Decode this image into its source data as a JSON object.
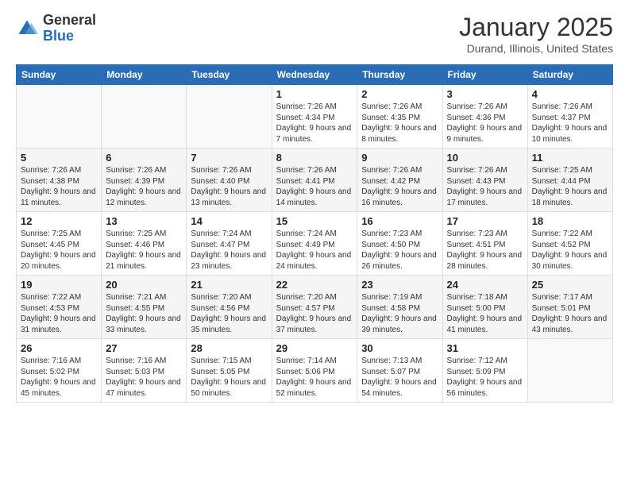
{
  "logo": {
    "general": "General",
    "blue": "Blue"
  },
  "title": "January 2025",
  "location": "Durand, Illinois, United States",
  "days_of_week": [
    "Sunday",
    "Monday",
    "Tuesday",
    "Wednesday",
    "Thursday",
    "Friday",
    "Saturday"
  ],
  "weeks": [
    [
      {
        "day": "",
        "info": ""
      },
      {
        "day": "",
        "info": ""
      },
      {
        "day": "",
        "info": ""
      },
      {
        "day": "1",
        "info": "Sunrise: 7:26 AM\nSunset: 4:34 PM\nDaylight: 9 hours and 7 minutes."
      },
      {
        "day": "2",
        "info": "Sunrise: 7:26 AM\nSunset: 4:35 PM\nDaylight: 9 hours and 8 minutes."
      },
      {
        "day": "3",
        "info": "Sunrise: 7:26 AM\nSunset: 4:36 PM\nDaylight: 9 hours and 9 minutes."
      },
      {
        "day": "4",
        "info": "Sunrise: 7:26 AM\nSunset: 4:37 PM\nDaylight: 9 hours and 10 minutes."
      }
    ],
    [
      {
        "day": "5",
        "info": "Sunrise: 7:26 AM\nSunset: 4:38 PM\nDaylight: 9 hours and 11 minutes."
      },
      {
        "day": "6",
        "info": "Sunrise: 7:26 AM\nSunset: 4:39 PM\nDaylight: 9 hours and 12 minutes."
      },
      {
        "day": "7",
        "info": "Sunrise: 7:26 AM\nSunset: 4:40 PM\nDaylight: 9 hours and 13 minutes."
      },
      {
        "day": "8",
        "info": "Sunrise: 7:26 AM\nSunset: 4:41 PM\nDaylight: 9 hours and 14 minutes."
      },
      {
        "day": "9",
        "info": "Sunrise: 7:26 AM\nSunset: 4:42 PM\nDaylight: 9 hours and 16 minutes."
      },
      {
        "day": "10",
        "info": "Sunrise: 7:26 AM\nSunset: 4:43 PM\nDaylight: 9 hours and 17 minutes."
      },
      {
        "day": "11",
        "info": "Sunrise: 7:25 AM\nSunset: 4:44 PM\nDaylight: 9 hours and 18 minutes."
      }
    ],
    [
      {
        "day": "12",
        "info": "Sunrise: 7:25 AM\nSunset: 4:45 PM\nDaylight: 9 hours and 20 minutes."
      },
      {
        "day": "13",
        "info": "Sunrise: 7:25 AM\nSunset: 4:46 PM\nDaylight: 9 hours and 21 minutes."
      },
      {
        "day": "14",
        "info": "Sunrise: 7:24 AM\nSunset: 4:47 PM\nDaylight: 9 hours and 23 minutes."
      },
      {
        "day": "15",
        "info": "Sunrise: 7:24 AM\nSunset: 4:49 PM\nDaylight: 9 hours and 24 minutes."
      },
      {
        "day": "16",
        "info": "Sunrise: 7:23 AM\nSunset: 4:50 PM\nDaylight: 9 hours and 26 minutes."
      },
      {
        "day": "17",
        "info": "Sunrise: 7:23 AM\nSunset: 4:51 PM\nDaylight: 9 hours and 28 minutes."
      },
      {
        "day": "18",
        "info": "Sunrise: 7:22 AM\nSunset: 4:52 PM\nDaylight: 9 hours and 30 minutes."
      }
    ],
    [
      {
        "day": "19",
        "info": "Sunrise: 7:22 AM\nSunset: 4:53 PM\nDaylight: 9 hours and 31 minutes."
      },
      {
        "day": "20",
        "info": "Sunrise: 7:21 AM\nSunset: 4:55 PM\nDaylight: 9 hours and 33 minutes."
      },
      {
        "day": "21",
        "info": "Sunrise: 7:20 AM\nSunset: 4:56 PM\nDaylight: 9 hours and 35 minutes."
      },
      {
        "day": "22",
        "info": "Sunrise: 7:20 AM\nSunset: 4:57 PM\nDaylight: 9 hours and 37 minutes."
      },
      {
        "day": "23",
        "info": "Sunrise: 7:19 AM\nSunset: 4:58 PM\nDaylight: 9 hours and 39 minutes."
      },
      {
        "day": "24",
        "info": "Sunrise: 7:18 AM\nSunset: 5:00 PM\nDaylight: 9 hours and 41 minutes."
      },
      {
        "day": "25",
        "info": "Sunrise: 7:17 AM\nSunset: 5:01 PM\nDaylight: 9 hours and 43 minutes."
      }
    ],
    [
      {
        "day": "26",
        "info": "Sunrise: 7:16 AM\nSunset: 5:02 PM\nDaylight: 9 hours and 45 minutes."
      },
      {
        "day": "27",
        "info": "Sunrise: 7:16 AM\nSunset: 5:03 PM\nDaylight: 9 hours and 47 minutes."
      },
      {
        "day": "28",
        "info": "Sunrise: 7:15 AM\nSunset: 5:05 PM\nDaylight: 9 hours and 50 minutes."
      },
      {
        "day": "29",
        "info": "Sunrise: 7:14 AM\nSunset: 5:06 PM\nDaylight: 9 hours and 52 minutes."
      },
      {
        "day": "30",
        "info": "Sunrise: 7:13 AM\nSunset: 5:07 PM\nDaylight: 9 hours and 54 minutes."
      },
      {
        "day": "31",
        "info": "Sunrise: 7:12 AM\nSunset: 5:09 PM\nDaylight: 9 hours and 56 minutes."
      },
      {
        "day": "",
        "info": ""
      }
    ]
  ]
}
